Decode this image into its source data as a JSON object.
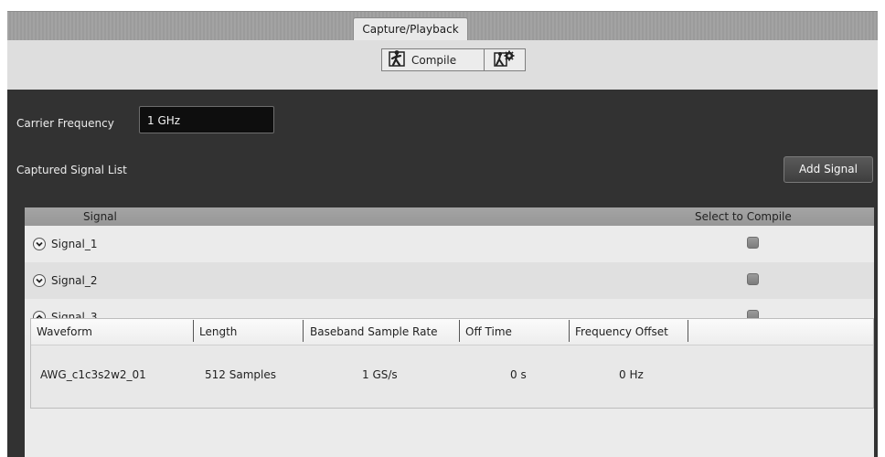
{
  "tabs": [
    {
      "label": "Capture/Playback"
    }
  ],
  "toolbar": {
    "compile_label": "Compile",
    "compile_icon": "runner-figure-icon",
    "settings_icon": "runner-gear-icon"
  },
  "panel": {
    "carrier_label": "Carrier Frequency",
    "carrier_value": "1 GHz",
    "list_title": "Captured Signal List",
    "add_signal_label": "Add Signal"
  },
  "signal_table": {
    "columns": [
      "Signal",
      "Select to Compile"
    ],
    "rows": [
      {
        "name": "Signal_1",
        "expanded": false,
        "selected": false
      },
      {
        "name": "Signal_2",
        "expanded": false,
        "selected": false
      },
      {
        "name": "Signal_3",
        "expanded": true,
        "selected": false
      }
    ]
  },
  "waveform_table": {
    "columns": [
      "Waveform",
      "Length",
      "Baseband Sample Rate",
      "Off Time",
      "Frequency Offset"
    ],
    "rows": [
      {
        "waveform": "AWG_c1c3s2w2_01",
        "length": "512 Samples",
        "rate": "1 GS/s",
        "off_time": "0 s",
        "freq_offset": "0 Hz"
      }
    ]
  },
  "colors": {
    "panel_bg": "#323232",
    "toolbar_bg": "#dedede",
    "input_bg": "#0e0e0e"
  }
}
